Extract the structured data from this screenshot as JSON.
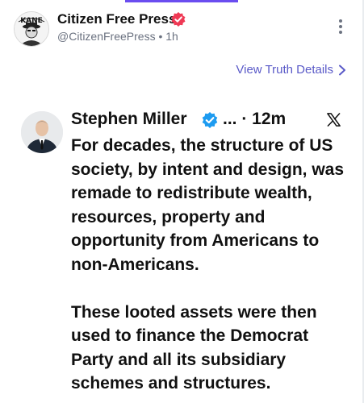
{
  "post": {
    "author_name": "Citizen Free Press",
    "handle": "@CitizenFreePress",
    "separator": "•",
    "time": "1h",
    "avatar_text": "KANE",
    "view_details_label": "View Truth Details"
  },
  "embed": {
    "author_name": "Stephen Miller",
    "meta": "... · 12m",
    "paragraphs": [
      "For decades, the structure of US society, by intent and design, was remade to redistribute wealth, resources, property and opportunity from Americans to non-Americans.",
      "These looted assets were then used to finance the Democrat Party and all its subsidiary schemes and structures."
    ]
  },
  "colors": {
    "accent": "#6a4df0",
    "verified": "#ef3a55",
    "embed_verified": "#1d9bf0",
    "link": "#5a5ac8",
    "muted": "#6b7280"
  },
  "icons": [
    "verified-badge-icon",
    "kebab-menu-icon",
    "chevron-right-icon",
    "x-logo-icon"
  ]
}
